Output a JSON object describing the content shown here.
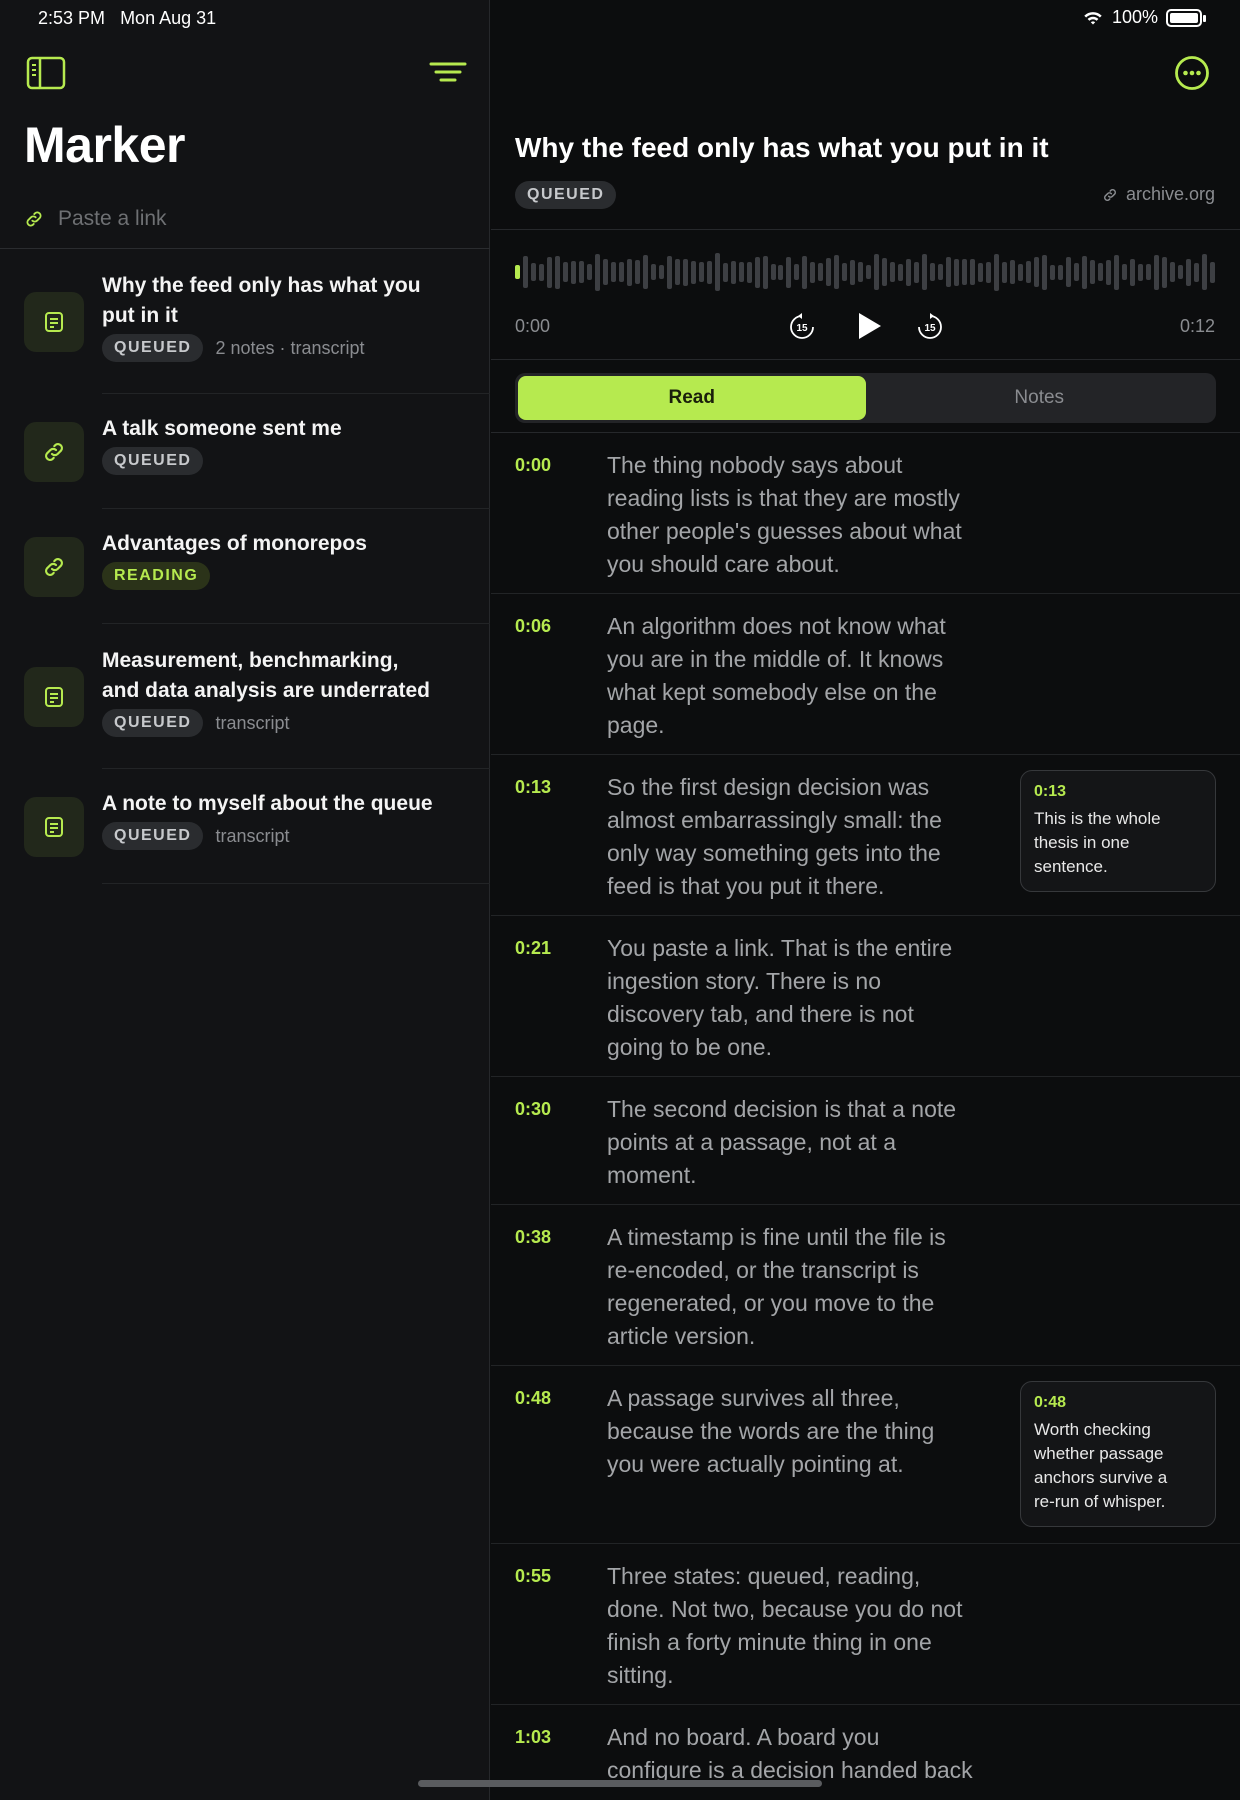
{
  "status_bar": {
    "time": "2:53 PM",
    "date": "Mon Aug 31",
    "battery": "100%"
  },
  "sidebar": {
    "app_title": "Marker",
    "paste_placeholder": "Paste a link",
    "items": [
      {
        "title_line1": "Why the feed only has what you",
        "title_line2": "put in it",
        "status": "QUEUED",
        "meta": "2 notes · transcript",
        "icon": "document-icon"
      },
      {
        "title_line1": "A talk someone sent me",
        "title_line2": "",
        "status": "QUEUED",
        "meta": "",
        "icon": "link-icon"
      },
      {
        "title_line1": "Advantages of monorepos",
        "title_line2": "",
        "status": "READING",
        "meta": "",
        "icon": "link-icon"
      },
      {
        "title_line1": "Measurement, benchmarking,",
        "title_line2": "and data analysis are underrated",
        "status": "QUEUED",
        "meta": "transcript",
        "icon": "document-icon"
      },
      {
        "title_line1": "A note to myself about the queue",
        "title_line2": "",
        "status": "QUEUED",
        "meta": "transcript",
        "icon": "document-icon"
      }
    ]
  },
  "detail": {
    "title": "Why the feed only has what you put in it",
    "status": "QUEUED",
    "source": "archive.org",
    "player": {
      "current": "0:00",
      "duration": "0:12",
      "skip_back": "15",
      "skip_forward": "15",
      "progress": 0.0
    },
    "tabs": {
      "read": "Read",
      "notes": "Notes"
    },
    "transcript": [
      {
        "time": "0:00",
        "l1": "The thing nobody says about",
        "l2": "reading lists is that they are mostly",
        "l3": "other people's guesses about what",
        "l4": "you should care about."
      },
      {
        "time": "0:06",
        "l1": "An algorithm does not know what",
        "l2": "you are in the middle of. It knows",
        "l3": "what kept somebody else on the",
        "l4": "page."
      },
      {
        "time": "0:13",
        "l1": "So the first design decision was",
        "l2": "almost embarrassingly small: the",
        "l3": "only way something gets into the",
        "l4": "feed is that you put it there.",
        "note_time": "0:13",
        "note_l1": "This is the whole",
        "note_l2": "thesis in one",
        "note_l3": "sentence.",
        "note_l4": ""
      },
      {
        "time": "0:21",
        "l1": "You paste a link. That is the entire",
        "l2": "ingestion story. There is no",
        "l3": "discovery tab, and there is not",
        "l4": "going to be one."
      },
      {
        "time": "0:30",
        "l1": "The second decision is that a note",
        "l2": "points at a passage, not at a",
        "l3": "moment.",
        "l4": ""
      },
      {
        "time": "0:38",
        "l1": "A timestamp is fine until the file is",
        "l2": "re-encoded, or the transcript is",
        "l3": "regenerated, or you move to the",
        "l4": "article version."
      },
      {
        "time": "0:48",
        "l1": "A passage survives all three,",
        "l2": "because the words are the thing",
        "l3": "you were actually pointing at.",
        "l4": "",
        "note_time": "0:48",
        "note_l1": "Worth checking",
        "note_l2": "whether passage",
        "note_l3": "anchors survive a",
        "note_l4": "re-run of whisper."
      },
      {
        "time": "0:55",
        "l1": "Three states: queued, reading,",
        "l2": "done. Not two, because you do not",
        "l3": "finish a forty minute thing in one",
        "l4": "sitting."
      },
      {
        "time": "1:03",
        "l1": "And no board. A board you",
        "l2": "configure is a decision handed back",
        "l3": "",
        "l4": ""
      }
    ]
  },
  "colors": {
    "accent": "#b6ea4f",
    "background": "#0c0d0e",
    "sidebar": "#121315"
  }
}
